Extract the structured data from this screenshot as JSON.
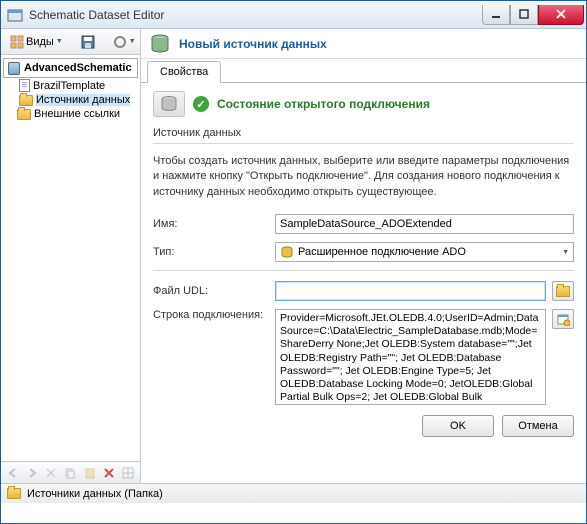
{
  "title": "Schematic Dataset Editor",
  "left_toolbar": {
    "views_label": "Виды"
  },
  "tree": {
    "root": "AdvancedSchematic",
    "items": [
      {
        "label": "BrazilTemplate"
      },
      {
        "label": "Источники данных"
      },
      {
        "label": "Внешние ссылки"
      }
    ]
  },
  "right": {
    "header_link": "Новый источник данных",
    "tab": "Свойства",
    "status": "Состояние открытого подключения",
    "group_label": "Источник данных",
    "description": "Чтобы создать источник данных, выберите или введите параметры подключения и нажмите кнопку \"Открыть подключение\". Для создания нового подключения к источнику данных необходимо открыть существующее.",
    "name_label": "Имя:",
    "name_value": "SampleDataSource_ADOExtended",
    "type_label": "Тип:",
    "type_value": "Расширенное подключение ADO",
    "udl_label": "Файл UDL:",
    "udl_value": "",
    "conn_label": "Строка подключения:",
    "conn_value": "Provider=Microsoft.JEt.OLEDB.4.0;UserID=Admin;Data Source=C:\\Data\\Electric_SampleDatabase.mdb;Mode=ShareDerry None;Jet OLEDB:System database=\"\";Jet OLEDB:Registry Path=\"\"; Jet OLEDB:Database Password=\"\"; Jet OLEDB:Engine Type=5; Jet OLEDB:Database Locking Mode=0; JetOLEDB:Global Partial Bulk Ops=2; Jet OLEDB:Global Bulk",
    "ok": "OK",
    "cancel": "Отмена"
  },
  "statusbar": "Источники данных (Папка)"
}
